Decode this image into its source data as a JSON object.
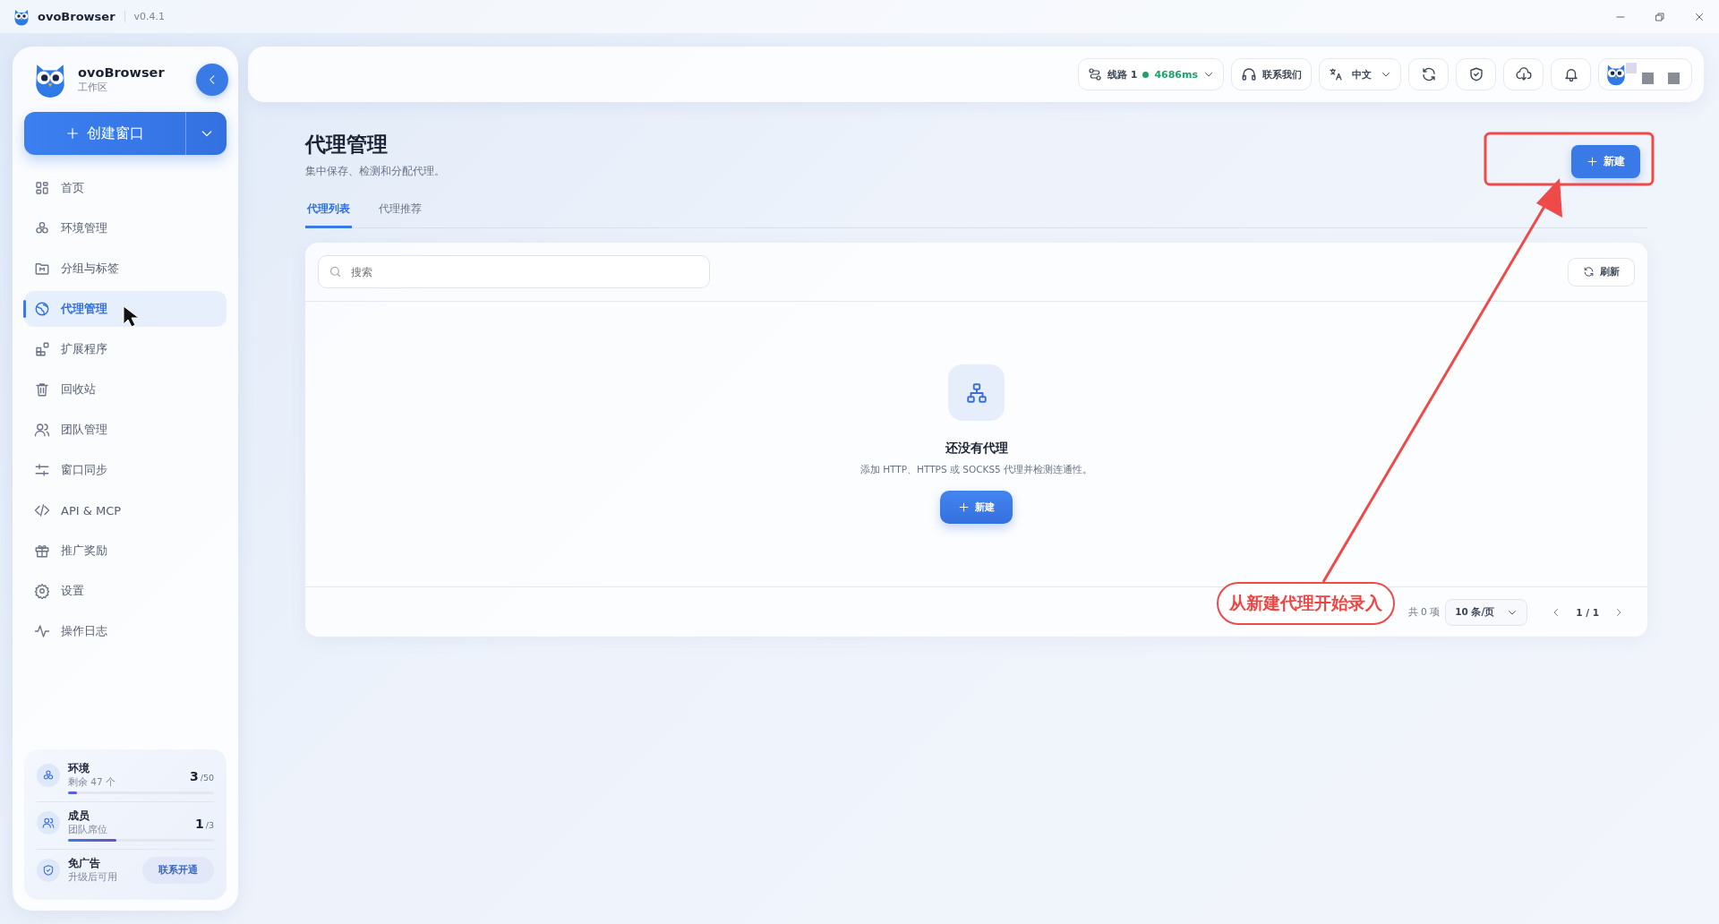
{
  "titlebar": {
    "app_name": "ovoBrowser",
    "version": "v0.4.1"
  },
  "sidebar": {
    "brand": "ovoBrowser",
    "workspace": "工作区",
    "create_button": "创建窗口",
    "nav": [
      {
        "label": "首页",
        "selected": false
      },
      {
        "label": "环境管理",
        "selected": false
      },
      {
        "label": "分组与标签",
        "selected": false
      },
      {
        "label": "代理管理",
        "selected": true
      },
      {
        "label": "扩展程序",
        "selected": false
      },
      {
        "label": "回收站",
        "selected": false
      },
      {
        "label": "团队管理",
        "selected": false
      },
      {
        "label": "窗口同步",
        "selected": false
      },
      {
        "label": "API & MCP",
        "selected": false
      },
      {
        "label": "推广奖励",
        "selected": false
      },
      {
        "label": "设置",
        "selected": false
      },
      {
        "label": "操作日志",
        "selected": false
      }
    ],
    "quota": [
      {
        "kind": "meter",
        "title": "环境",
        "subtitle": "剩余 47 个",
        "count": "3",
        "total": "/50",
        "level": 0.06
      },
      {
        "kind": "meter",
        "title": "成员",
        "subtitle": "团队席位",
        "count": "1",
        "total": "/3",
        "level": 0.33
      },
      {
        "kind": "action",
        "title": "免广告",
        "subtitle": "升级后可用",
        "button": "联系开通"
      }
    ]
  },
  "topbar": {
    "route": {
      "label": "线路 1",
      "latency": "4686ms"
    },
    "contact": "联系我们",
    "language": "中文"
  },
  "page": {
    "title": "代理管理",
    "subtitle": "集中保存、检测和分配代理。",
    "new_button": "新建",
    "tabs": [
      {
        "label": "代理列表",
        "selected": true
      },
      {
        "label": "代理推荐",
        "selected": false
      }
    ],
    "search": {
      "placeholder": "搜索"
    },
    "refresh_button": "刷新",
    "empty": {
      "title": "还没有代理",
      "description": "添加 HTTP、HTTPS 或 SOCKS5 代理并检测连通性。",
      "button": "新建"
    },
    "pagination": {
      "total": "共 0 项",
      "page_size": "10 条/页",
      "page": "1 / 1"
    }
  },
  "annotation": {
    "text": "从新建代理开始录入"
  }
}
